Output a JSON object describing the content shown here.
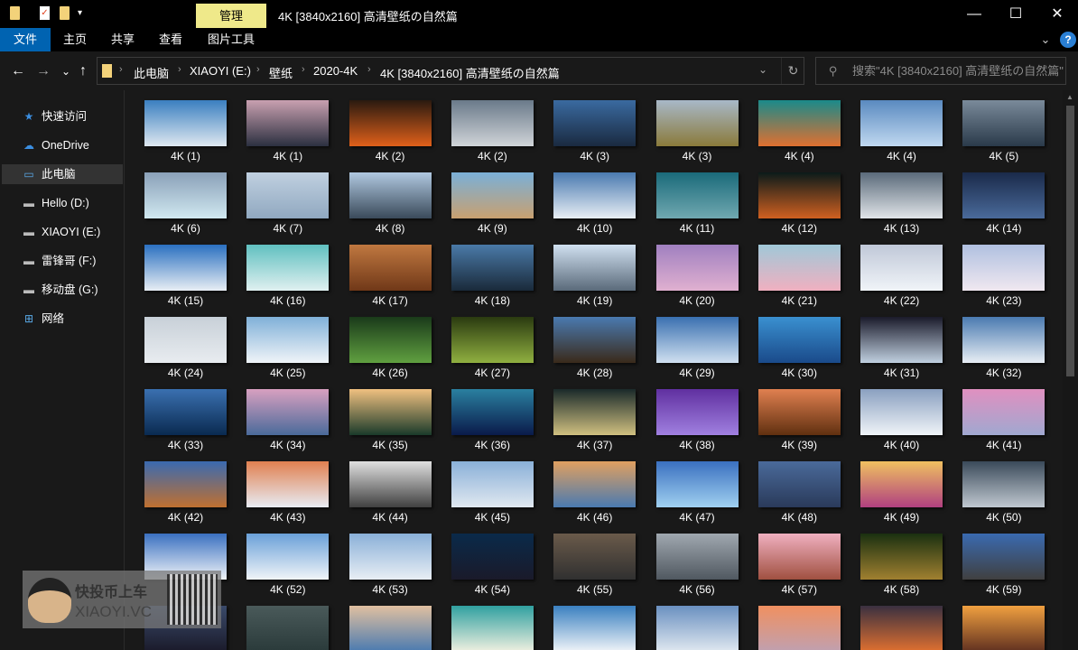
{
  "window": {
    "title": "4K [3840x2160] 高清壁纸の自然篇",
    "context_tab": "管理",
    "minimize": "—",
    "maximize": "☐",
    "close": "✕"
  },
  "ribbon": {
    "tabs": [
      "文件",
      "主页",
      "共享",
      "查看",
      "图片工具"
    ],
    "collapse": "⌄",
    "help": "?"
  },
  "nav": {
    "back": "←",
    "forward": "→",
    "recent": "⌄",
    "up": "↑"
  },
  "address": {
    "crumbs": [
      "此电脑",
      "XIAOYI (E:)",
      "壁纸",
      "2020-4K",
      "4K [3840x2160] 高清壁纸の自然篇"
    ],
    "separator": "›",
    "dropdown": "⌄",
    "refresh": "↻"
  },
  "search": {
    "placeholder": "搜索\"4K [3840x2160] 高清壁纸の自然篇\"",
    "icon": "⚲"
  },
  "sidebar": {
    "items": [
      {
        "label": "快速访问",
        "icon": "★",
        "color": "#3b8ee0"
      },
      {
        "label": "OneDrive",
        "icon": "☁",
        "color": "#3b8ee0"
      },
      {
        "label": "此电脑",
        "icon": "▭",
        "color": "#5aaae8"
      },
      {
        "label": "Hello (D:)",
        "icon": "▬",
        "color": "#bbb"
      },
      {
        "label": "XIAOYI (E:)",
        "icon": "▬",
        "color": "#bbb"
      },
      {
        "label": "雷锋哥 (F:)",
        "icon": "▬",
        "color": "#bbb"
      },
      {
        "label": "移动盘 (G:)",
        "icon": "▬",
        "color": "#bbb"
      },
      {
        "label": "网络",
        "icon": "⊞",
        "color": "#5aaae8"
      }
    ]
  },
  "files": [
    {
      "label": "4K (1)",
      "c": [
        "#3a7fc0",
        "#dfe8f0"
      ]
    },
    {
      "label": "4K (1)",
      "c": [
        "#c9a0b0",
        "#2b3040"
      ]
    },
    {
      "label": "4K (2)",
      "c": [
        "#2a1a10",
        "#e0601a"
      ]
    },
    {
      "label": "4K (2)",
      "c": [
        "#6a7a8a",
        "#d0d4d8"
      ]
    },
    {
      "label": "4K (3)",
      "c": [
        "#3a6aa0",
        "#1a2a40"
      ]
    },
    {
      "label": "4K (3)",
      "c": [
        "#a8b8c8",
        "#8a7a3a"
      ]
    },
    {
      "label": "4K (4)",
      "c": [
        "#1a8a8a",
        "#e07030"
      ]
    },
    {
      "label": "4K (4)",
      "c": [
        "#5a8ac0",
        "#c0d8f0"
      ]
    },
    {
      "label": "4K (5)",
      "c": [
        "#7a8a9a",
        "#2a3a4a"
      ]
    },
    {
      "label": "4K (6)",
      "c": [
        "#8aa0b8",
        "#d0e8f0"
      ]
    },
    {
      "label": "4K (7)",
      "c": [
        "#c0d0e0",
        "#90a8c0"
      ]
    },
    {
      "label": "4K (8)",
      "c": [
        "#b0c8e0",
        "#3a4a5a"
      ]
    },
    {
      "label": "4K (9)",
      "c": [
        "#7ab0d8",
        "#c8a070"
      ]
    },
    {
      "label": "4K (10)",
      "c": [
        "#4a7ab0",
        "#e8eef4"
      ]
    },
    {
      "label": "4K (11)",
      "c": [
        "#1a6a7a",
        "#70a8b0"
      ]
    },
    {
      "label": "4K (12)",
      "c": [
        "#0a1a1a",
        "#d06020"
      ]
    },
    {
      "label": "4K (13)",
      "c": [
        "#5a6a7a",
        "#e0e4e8"
      ]
    },
    {
      "label": "4K (14)",
      "c": [
        "#1a2a4a",
        "#4a6a9a"
      ]
    },
    {
      "label": "4K (15)",
      "c": [
        "#2a70c0",
        "#e8eef4"
      ]
    },
    {
      "label": "4K (16)",
      "c": [
        "#60c0c0",
        "#e0f0f0"
      ]
    },
    {
      "label": "4K (17)",
      "c": [
        "#c07840",
        "#703818"
      ]
    },
    {
      "label": "4K (18)",
      "c": [
        "#4a7aa8",
        "#1a2a3a"
      ]
    },
    {
      "label": "4K (19)",
      "c": [
        "#d0e0f0",
        "#5a6a7a"
      ]
    },
    {
      "label": "4K (20)",
      "c": [
        "#a080c0",
        "#e0b0d0"
      ]
    },
    {
      "label": "4K (21)",
      "c": [
        "#a0c8d8",
        "#f0b0c0"
      ]
    },
    {
      "label": "4K (22)",
      "c": [
        "#c0c8d8",
        "#f0f4f8"
      ]
    },
    {
      "label": "4K (23)",
      "c": [
        "#b0c0e0",
        "#f0e8f0"
      ]
    },
    {
      "label": "4K (24)",
      "c": [
        "#c8d0d8",
        "#e8ecf0"
      ]
    },
    {
      "label": "4K (25)",
      "c": [
        "#80b0d8",
        "#f0f4f8"
      ]
    },
    {
      "label": "4K (26)",
      "c": [
        "#1a3a1a",
        "#60a040"
      ]
    },
    {
      "label": "4K (27)",
      "c": [
        "#2a3a10",
        "#90b040"
      ]
    },
    {
      "label": "4K (28)",
      "c": [
        "#4a7ab0",
        "#3a2a1a"
      ]
    },
    {
      "label": "4K (29)",
      "c": [
        "#3a70b0",
        "#d0e0f0"
      ]
    },
    {
      "label": "4K (30)",
      "c": [
        "#3a90d0",
        "#1a4a8a"
      ]
    },
    {
      "label": "4K (31)",
      "c": [
        "#1a1a2a",
        "#c0d0e0"
      ]
    },
    {
      "label": "4K (32)",
      "c": [
        "#4a7ab0",
        "#e8eef4"
      ]
    },
    {
      "label": "4K (33)",
      "c": [
        "#3a70b0",
        "#0a2a50"
      ]
    },
    {
      "label": "4K (34)",
      "c": [
        "#d8a0c0",
        "#4a6a9a"
      ]
    },
    {
      "label": "4K (35)",
      "c": [
        "#f0c080",
        "#1a3a2a"
      ]
    },
    {
      "label": "4K (36)",
      "c": [
        "#2a80a0",
        "#0a1a4a"
      ]
    },
    {
      "label": "4K (37)",
      "c": [
        "#1a2a2a",
        "#d0c080"
      ]
    },
    {
      "label": "4K (38)",
      "c": [
        "#6030a0",
        "#a080e0"
      ]
    },
    {
      "label": "4K (39)",
      "c": [
        "#e08050",
        "#603010"
      ]
    },
    {
      "label": "4K (40)",
      "c": [
        "#8aa0c0",
        "#f0f4f8"
      ]
    },
    {
      "label": "4K (41)",
      "c": [
        "#e090c0",
        "#a0a8d0"
      ]
    },
    {
      "label": "4K (42)",
      "c": [
        "#3a6ab0",
        "#c07030"
      ]
    },
    {
      "label": "4K (43)",
      "c": [
        "#e08050",
        "#e8ecf4"
      ]
    },
    {
      "label": "4K (44)",
      "c": [
        "#e0e0e0",
        "#404040"
      ]
    },
    {
      "label": "4K (45)",
      "c": [
        "#8ab0d8",
        "#e0e8f0"
      ]
    },
    {
      "label": "4K (46)",
      "c": [
        "#e0a060",
        "#4a7ab0"
      ]
    },
    {
      "label": "4K (47)",
      "c": [
        "#3a70c0",
        "#a0d0f0"
      ]
    },
    {
      "label": "4K (48)",
      "c": [
        "#4a6a9a",
        "#2a3a5a"
      ]
    },
    {
      "label": "4K (49)",
      "c": [
        "#f0c060",
        "#b04080"
      ]
    },
    {
      "label": "4K (50)",
      "c": [
        "#3a4a5a",
        "#c0c8d0"
      ]
    },
    {
      "label": "",
      "c": [
        "#3a70c0",
        "#f0f4f8"
      ]
    },
    {
      "label": "4K (52)",
      "c": [
        "#6aa0d8",
        "#f0f4f8"
      ]
    },
    {
      "label": "4K (53)",
      "c": [
        "#8ab0d8",
        "#e8eef4"
      ]
    },
    {
      "label": "4K (54)",
      "c": [
        "#0a2a4a",
        "#1a1a2a"
      ]
    },
    {
      "label": "4K (55)",
      "c": [
        "#6a5a4a",
        "#303030"
      ]
    },
    {
      "label": "4K (56)",
      "c": [
        "#a0a8b0",
        "#505860"
      ]
    },
    {
      "label": "4K (57)",
      "c": [
        "#f0b0c0",
        "#a05040"
      ]
    },
    {
      "label": "4K (58)",
      "c": [
        "#1a3010",
        "#a08030"
      ]
    },
    {
      "label": "4K (59)",
      "c": [
        "#3a6ab0",
        "#404040"
      ]
    },
    {
      "label": "",
      "c": [
        "#3a4a6a",
        "#1a1a2a"
      ]
    },
    {
      "label": "",
      "c": [
        "#4a5a5a",
        "#2a3a3a"
      ]
    },
    {
      "label": "",
      "c": [
        "#e0c0a0",
        "#4a7ab0"
      ]
    },
    {
      "label": "",
      "c": [
        "#30a0a0",
        "#f0f0e0"
      ]
    },
    {
      "label": "",
      "c": [
        "#3a80c0",
        "#f0f4f8"
      ]
    },
    {
      "label": "",
      "c": [
        "#6a90c0",
        "#e0e8f0"
      ]
    },
    {
      "label": "",
      "c": [
        "#f09060",
        "#c0a0b0"
      ]
    },
    {
      "label": "",
      "c": [
        "#3a3040",
        "#e07030"
      ]
    },
    {
      "label": "",
      "c": [
        "#f0a040",
        "#603020"
      ]
    }
  ],
  "watermark": {
    "line1": "快投币上车",
    "line2": "XIAOYI.VC"
  },
  "colors": {
    "accent": "#0063b1",
    "context": "#efe98a"
  }
}
